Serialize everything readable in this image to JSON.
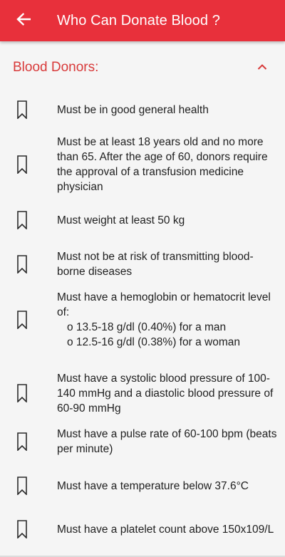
{
  "appbar": {
    "title": "Who Can Donate Blood ?",
    "back_icon": "arrow-left-icon",
    "color": "#e8303b"
  },
  "section": {
    "title": "Blood Donors:",
    "toggle_icon": "chevron-up-icon",
    "accent": "#d83a3a"
  },
  "items": [
    {
      "icon": "bookmark-outline-icon",
      "text": "Must be in good general health"
    },
    {
      "icon": "bookmark-outline-icon",
      "text": "Must be at least 18 years old and no more than 65. After the age of 60, donors require the approval of a transfusion medicine physician"
    },
    {
      "icon": "bookmark-outline-icon",
      "text": "Must weight at least 50 kg"
    },
    {
      "icon": "bookmark-outline-icon",
      "text": "Must not be at risk of transmitting blood-borne diseases"
    },
    {
      "icon": "bookmark-outline-icon",
      "text": "Must have a hemoglobin or hematocrit level of:",
      "subitems": [
        "o 13.5-18 g/dl (0.40%) for a man",
        "o 12.5-16 g/dl (0.38%) for a woman"
      ]
    },
    {
      "icon": "bookmark-outline-icon",
      "text": "Must have a systolic blood pressure of 100-140 mmHg and a diastolic blood pressure of 60-90 mmHg"
    },
    {
      "icon": "bookmark-outline-icon",
      "text": "Must have a pulse rate of 60-100 bpm (beats per minute)"
    },
    {
      "icon": "bookmark-outline-icon",
      "text": "Must have a temperature below 37.6°C"
    },
    {
      "icon": "bookmark-outline-icon",
      "text": "Must have a platelet count above 150x109/L"
    }
  ]
}
